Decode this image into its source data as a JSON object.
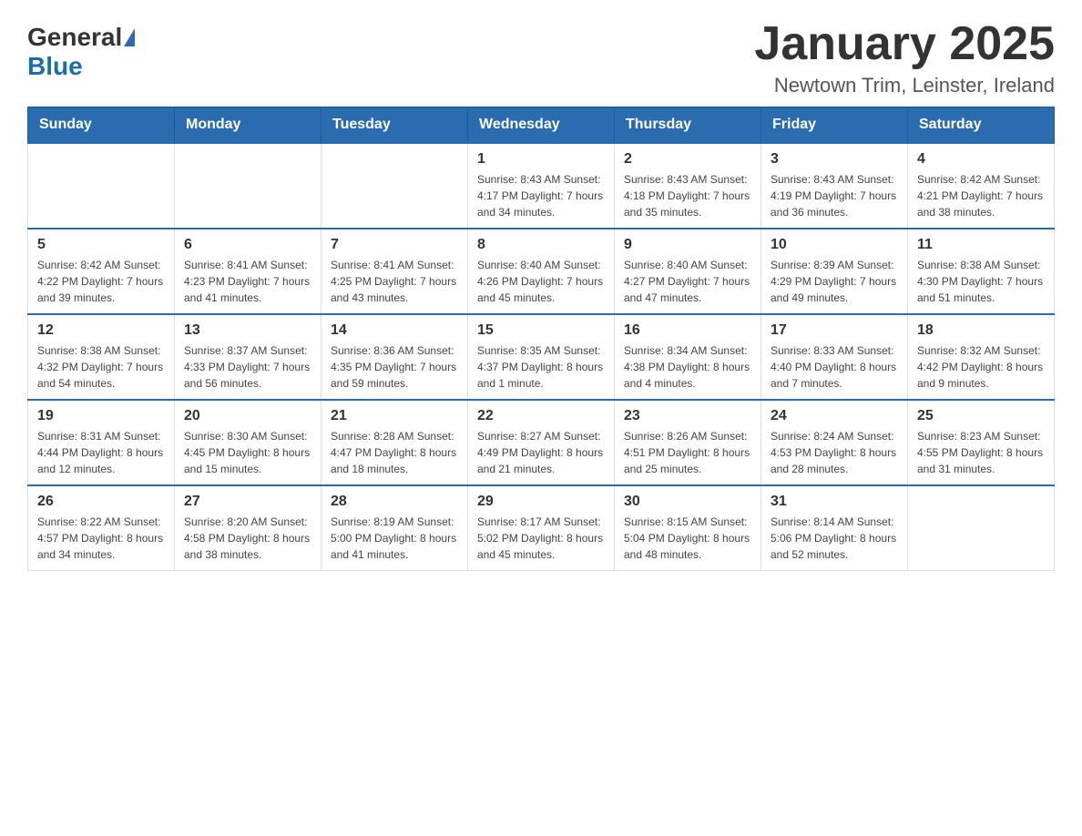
{
  "header": {
    "logo_general": "General",
    "logo_blue": "Blue",
    "title": "January 2025",
    "subtitle": "Newtown Trim, Leinster, Ireland"
  },
  "calendar": {
    "days_of_week": [
      "Sunday",
      "Monday",
      "Tuesday",
      "Wednesday",
      "Thursday",
      "Friday",
      "Saturday"
    ],
    "weeks": [
      [
        {
          "day": "",
          "info": ""
        },
        {
          "day": "",
          "info": ""
        },
        {
          "day": "",
          "info": ""
        },
        {
          "day": "1",
          "info": "Sunrise: 8:43 AM\nSunset: 4:17 PM\nDaylight: 7 hours\nand 34 minutes."
        },
        {
          "day": "2",
          "info": "Sunrise: 8:43 AM\nSunset: 4:18 PM\nDaylight: 7 hours\nand 35 minutes."
        },
        {
          "day": "3",
          "info": "Sunrise: 8:43 AM\nSunset: 4:19 PM\nDaylight: 7 hours\nand 36 minutes."
        },
        {
          "day": "4",
          "info": "Sunrise: 8:42 AM\nSunset: 4:21 PM\nDaylight: 7 hours\nand 38 minutes."
        }
      ],
      [
        {
          "day": "5",
          "info": "Sunrise: 8:42 AM\nSunset: 4:22 PM\nDaylight: 7 hours\nand 39 minutes."
        },
        {
          "day": "6",
          "info": "Sunrise: 8:41 AM\nSunset: 4:23 PM\nDaylight: 7 hours\nand 41 minutes."
        },
        {
          "day": "7",
          "info": "Sunrise: 8:41 AM\nSunset: 4:25 PM\nDaylight: 7 hours\nand 43 minutes."
        },
        {
          "day": "8",
          "info": "Sunrise: 8:40 AM\nSunset: 4:26 PM\nDaylight: 7 hours\nand 45 minutes."
        },
        {
          "day": "9",
          "info": "Sunrise: 8:40 AM\nSunset: 4:27 PM\nDaylight: 7 hours\nand 47 minutes."
        },
        {
          "day": "10",
          "info": "Sunrise: 8:39 AM\nSunset: 4:29 PM\nDaylight: 7 hours\nand 49 minutes."
        },
        {
          "day": "11",
          "info": "Sunrise: 8:38 AM\nSunset: 4:30 PM\nDaylight: 7 hours\nand 51 minutes."
        }
      ],
      [
        {
          "day": "12",
          "info": "Sunrise: 8:38 AM\nSunset: 4:32 PM\nDaylight: 7 hours\nand 54 minutes."
        },
        {
          "day": "13",
          "info": "Sunrise: 8:37 AM\nSunset: 4:33 PM\nDaylight: 7 hours\nand 56 minutes."
        },
        {
          "day": "14",
          "info": "Sunrise: 8:36 AM\nSunset: 4:35 PM\nDaylight: 7 hours\nand 59 minutes."
        },
        {
          "day": "15",
          "info": "Sunrise: 8:35 AM\nSunset: 4:37 PM\nDaylight: 8 hours\nand 1 minute."
        },
        {
          "day": "16",
          "info": "Sunrise: 8:34 AM\nSunset: 4:38 PM\nDaylight: 8 hours\nand 4 minutes."
        },
        {
          "day": "17",
          "info": "Sunrise: 8:33 AM\nSunset: 4:40 PM\nDaylight: 8 hours\nand 7 minutes."
        },
        {
          "day": "18",
          "info": "Sunrise: 8:32 AM\nSunset: 4:42 PM\nDaylight: 8 hours\nand 9 minutes."
        }
      ],
      [
        {
          "day": "19",
          "info": "Sunrise: 8:31 AM\nSunset: 4:44 PM\nDaylight: 8 hours\nand 12 minutes."
        },
        {
          "day": "20",
          "info": "Sunrise: 8:30 AM\nSunset: 4:45 PM\nDaylight: 8 hours\nand 15 minutes."
        },
        {
          "day": "21",
          "info": "Sunrise: 8:28 AM\nSunset: 4:47 PM\nDaylight: 8 hours\nand 18 minutes."
        },
        {
          "day": "22",
          "info": "Sunrise: 8:27 AM\nSunset: 4:49 PM\nDaylight: 8 hours\nand 21 minutes."
        },
        {
          "day": "23",
          "info": "Sunrise: 8:26 AM\nSunset: 4:51 PM\nDaylight: 8 hours\nand 25 minutes."
        },
        {
          "day": "24",
          "info": "Sunrise: 8:24 AM\nSunset: 4:53 PM\nDaylight: 8 hours\nand 28 minutes."
        },
        {
          "day": "25",
          "info": "Sunrise: 8:23 AM\nSunset: 4:55 PM\nDaylight: 8 hours\nand 31 minutes."
        }
      ],
      [
        {
          "day": "26",
          "info": "Sunrise: 8:22 AM\nSunset: 4:57 PM\nDaylight: 8 hours\nand 34 minutes."
        },
        {
          "day": "27",
          "info": "Sunrise: 8:20 AM\nSunset: 4:58 PM\nDaylight: 8 hours\nand 38 minutes."
        },
        {
          "day": "28",
          "info": "Sunrise: 8:19 AM\nSunset: 5:00 PM\nDaylight: 8 hours\nand 41 minutes."
        },
        {
          "day": "29",
          "info": "Sunrise: 8:17 AM\nSunset: 5:02 PM\nDaylight: 8 hours\nand 45 minutes."
        },
        {
          "day": "30",
          "info": "Sunrise: 8:15 AM\nSunset: 5:04 PM\nDaylight: 8 hours\nand 48 minutes."
        },
        {
          "day": "31",
          "info": "Sunrise: 8:14 AM\nSunset: 5:06 PM\nDaylight: 8 hours\nand 52 minutes."
        },
        {
          "day": "",
          "info": ""
        }
      ]
    ]
  }
}
